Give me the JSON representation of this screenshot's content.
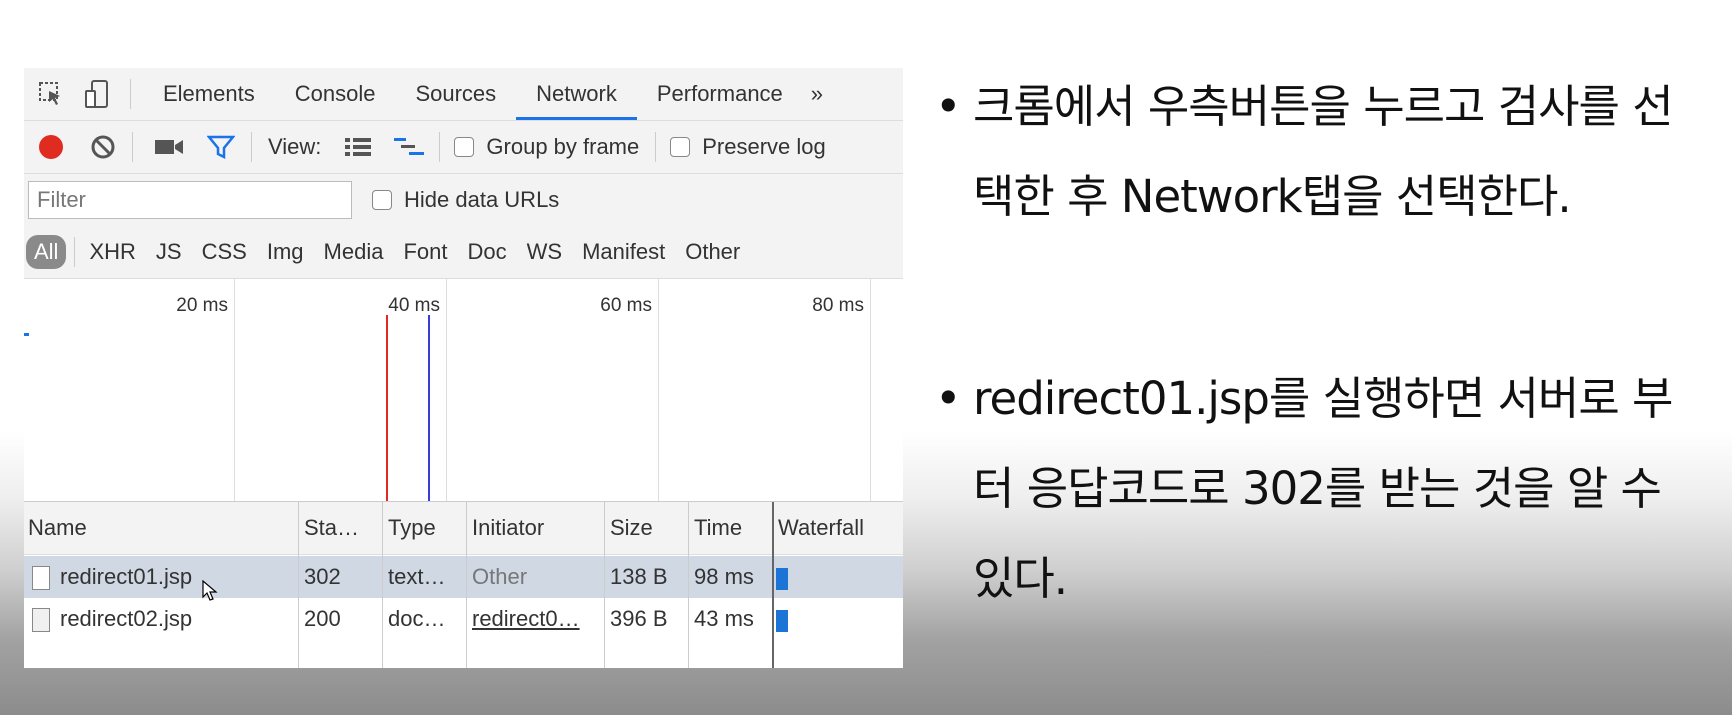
{
  "devtools": {
    "tabs": [
      "Elements",
      "Console",
      "Sources",
      "Network",
      "Performance"
    ],
    "active_tab": "Network",
    "more_tabs_glyph": "»",
    "toolbar": {
      "view_label": "View:",
      "group_by_frame_label": "Group by frame",
      "preserve_log_label": "Preserve log",
      "record_color": "#e02b20",
      "filter_icon_color": "#1a73e8"
    },
    "filter": {
      "placeholder": "Filter",
      "hide_data_urls_label": "Hide data URLs"
    },
    "type_filters": [
      "All",
      "XHR",
      "JS",
      "CSS",
      "Img",
      "Media",
      "Font",
      "Doc",
      "WS",
      "Manifest",
      "Other"
    ],
    "active_type_filter": "All",
    "timeline": {
      "ticks": [
        "20 ms",
        "40 ms",
        "60 ms",
        "80 ms"
      ],
      "dom_content_loaded_color": "#3b3bd9",
      "load_color": "#e02b20"
    },
    "table": {
      "columns": [
        "Name",
        "Sta…",
        "Type",
        "Initiator",
        "Size",
        "Time",
        "Waterfall"
      ],
      "rows": [
        {
          "name": "redirect01.jsp",
          "status": "302",
          "type": "text…",
          "initiator": "Other",
          "size": "138 B",
          "time": "98 ms",
          "selected": true
        },
        {
          "name": "redirect02.jsp",
          "status": "200",
          "type": "doc…",
          "initiator": "redirect0…",
          "size": "396 B",
          "time": "43 ms",
          "selected": false
        }
      ],
      "waterfall_color": "#1b74d6"
    }
  },
  "notes": {
    "bullets": [
      "크롬에서 우측버튼을 누르고 검사를 선택한 후 Network탭을 선택한다.",
      "redirect01.jsp를 실행하면 서버로 부터 응답코드로 302를 받는 것을 알 수 있다."
    ]
  }
}
